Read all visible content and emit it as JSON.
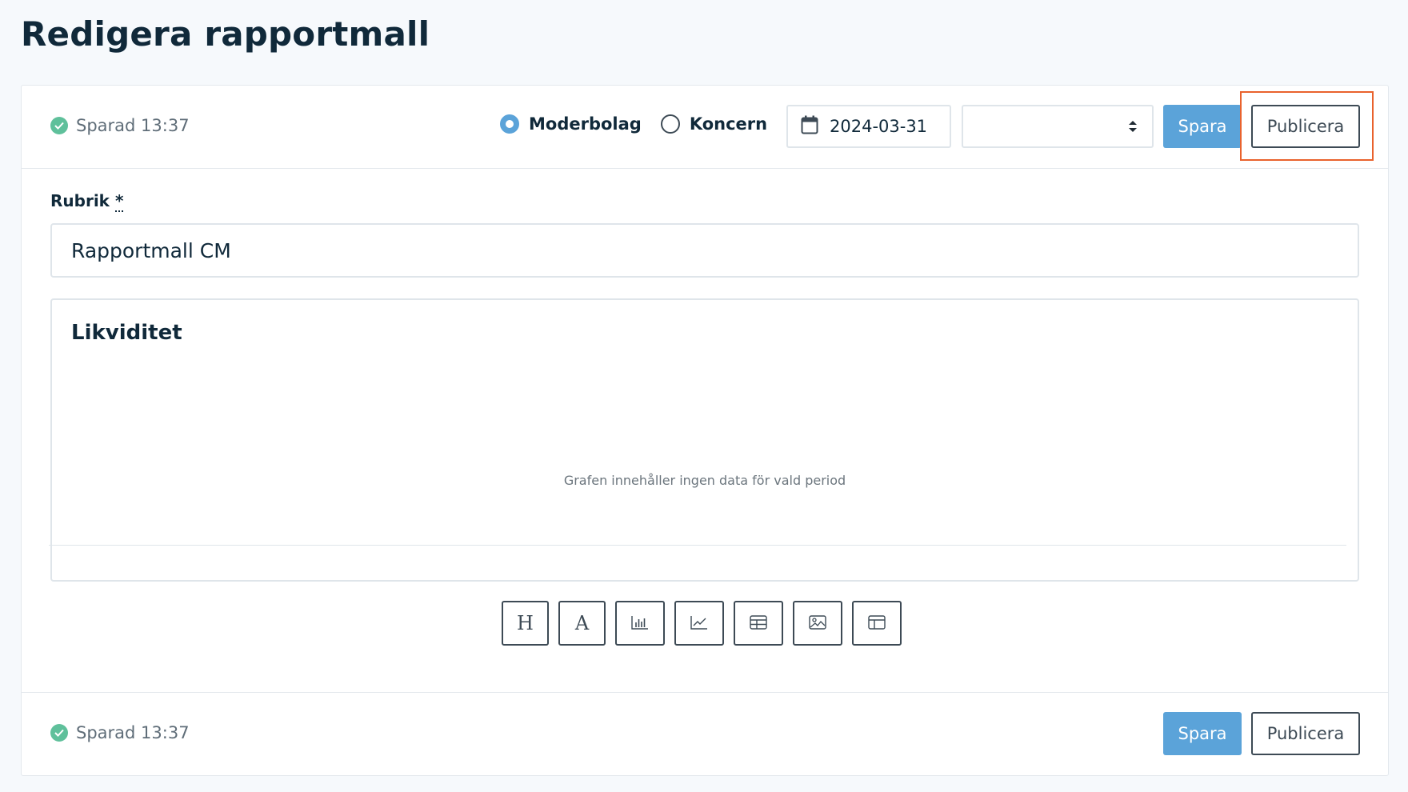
{
  "page": {
    "title": "Redigera rapportmall"
  },
  "toolbar": {
    "status": "Sparad 13:37",
    "radios": [
      {
        "label": "Moderbolag",
        "checked": true
      },
      {
        "label": "Koncern",
        "checked": false
      }
    ],
    "date": "2024-03-31",
    "select_value": "",
    "save_label": "Spara",
    "publish_label": "Publicera"
  },
  "form": {
    "rubrik_label": "Rubrik",
    "required_marker": "*",
    "rubrik_value": "Rapportmall CM"
  },
  "block": {
    "title": "Likviditet",
    "empty_message": "Grafen innehåller ingen data för vald period"
  },
  "tools": [
    {
      "name": "heading-tool",
      "glyph": "H"
    },
    {
      "name": "text-tool",
      "glyph": "A"
    },
    {
      "name": "bar-chart-tool",
      "icon": "bar-chart-icon"
    },
    {
      "name": "line-chart-tool",
      "icon": "line-chart-icon"
    },
    {
      "name": "table-tool",
      "icon": "table-icon"
    },
    {
      "name": "image-tool",
      "icon": "image-icon"
    },
    {
      "name": "layout-tool",
      "icon": "layout-icon"
    }
  ],
  "footer": {
    "status": "Sparad 13:37",
    "save_label": "Spara",
    "publish_label": "Publicera"
  },
  "colors": {
    "primary": "#5ba3d9",
    "success": "#5fc09b",
    "highlight": "#e9622d",
    "text": "#10293a"
  }
}
